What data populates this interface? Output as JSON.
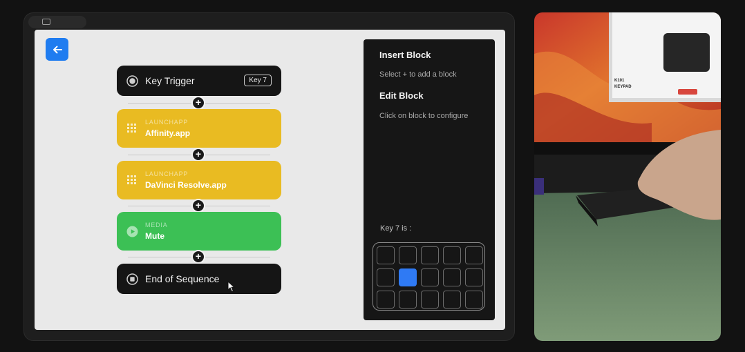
{
  "flow": {
    "trigger": {
      "title": "Key Trigger",
      "badge": "Key 7"
    },
    "blocks": [
      {
        "category": "LAUNCHAPP",
        "name": "Affinity.app",
        "icon": "grid-icon",
        "color": "#e9bb22"
      },
      {
        "category": "LAUNCHAPP",
        "name": "DaVinci Resolve.app",
        "icon": "grid-icon",
        "color": "#e9bb22"
      },
      {
        "category": "MEDIA",
        "name": "Mute",
        "icon": "play-icon",
        "color": "#3cc055"
      }
    ],
    "end": {
      "title": "End of Sequence"
    },
    "add_symbol": "+"
  },
  "panel": {
    "insert_title": "Insert Block",
    "insert_hint": "Select + to add a block",
    "edit_title": "Edit Block",
    "edit_hint": "Click on block to configure",
    "key_label": "Key 7 is :",
    "keypad": {
      "rows": 3,
      "cols": 5,
      "active_row": 1,
      "active_col": 1
    }
  },
  "photo": {
    "device_label_1": "K101",
    "device_label_2": "KEYPAD"
  },
  "colors": {
    "accent": "#1f7cf0",
    "active_key": "#2f7af4"
  }
}
